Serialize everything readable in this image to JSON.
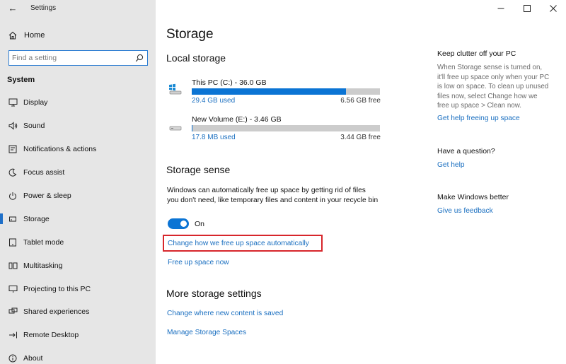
{
  "window": {
    "title": "Settings",
    "controls": {
      "minimize": "—",
      "maximize": "☐",
      "close": "✕"
    }
  },
  "sidebar": {
    "home_label": "Home",
    "search_placeholder": "Find a setting",
    "section": "System",
    "items": [
      {
        "label": "Display",
        "icon": "display-icon"
      },
      {
        "label": "Sound",
        "icon": "sound-icon"
      },
      {
        "label": "Notifications & actions",
        "icon": "notifications-icon"
      },
      {
        "label": "Focus assist",
        "icon": "focus-assist-icon"
      },
      {
        "label": "Power & sleep",
        "icon": "power-icon"
      },
      {
        "label": "Storage",
        "icon": "storage-icon",
        "active": true
      },
      {
        "label": "Tablet mode",
        "icon": "tablet-icon"
      },
      {
        "label": "Multitasking",
        "icon": "multitasking-icon"
      },
      {
        "label": "Projecting to this PC",
        "icon": "projecting-icon"
      },
      {
        "label": "Shared experiences",
        "icon": "shared-experiences-icon"
      },
      {
        "label": "Remote Desktop",
        "icon": "remote-desktop-icon"
      },
      {
        "label": "About",
        "icon": "about-icon"
      }
    ]
  },
  "main": {
    "title": "Storage",
    "local_storage": {
      "heading": "Local storage",
      "drives": [
        {
          "name": "This PC (C:) - 36.0 GB",
          "used": "29.4 GB used",
          "free": "6.56 GB free",
          "used_fraction": 0.82,
          "icon": "system-drive-icon"
        },
        {
          "name": "New Volume (E:) - 3.46 GB",
          "used": "17.8 MB used",
          "free": "3.44 GB free",
          "used_fraction": 0.005,
          "icon": "drive-icon"
        }
      ]
    },
    "storage_sense": {
      "heading": "Storage sense",
      "description": "Windows can automatically free up space by getting rid of files you don't need, like temporary files and content in your recycle bin",
      "toggle_state": "On",
      "change_link": "Change how we free up space automatically",
      "free_now_link": "Free up space now"
    },
    "more_settings": {
      "heading": "More storage settings",
      "links": [
        "Change where new content is saved",
        "Manage Storage Spaces"
      ]
    }
  },
  "side_panel": {
    "clutter": {
      "heading": "Keep clutter off your PC",
      "text": "When Storage sense is turned on, it'll free up space only when your PC is low on space. To clean up unused files now, select Change how we free up space > Clean now.",
      "link": "Get help freeing up space"
    },
    "question": {
      "heading": "Have a question?",
      "link": "Get help"
    },
    "better": {
      "heading": "Make Windows better",
      "link": "Give us feedback"
    }
  },
  "colors": {
    "accent": "#0b74d4",
    "link": "#1a6fc0",
    "sidebar_bg": "#e6e6e6",
    "highlight": "#d7262b"
  }
}
